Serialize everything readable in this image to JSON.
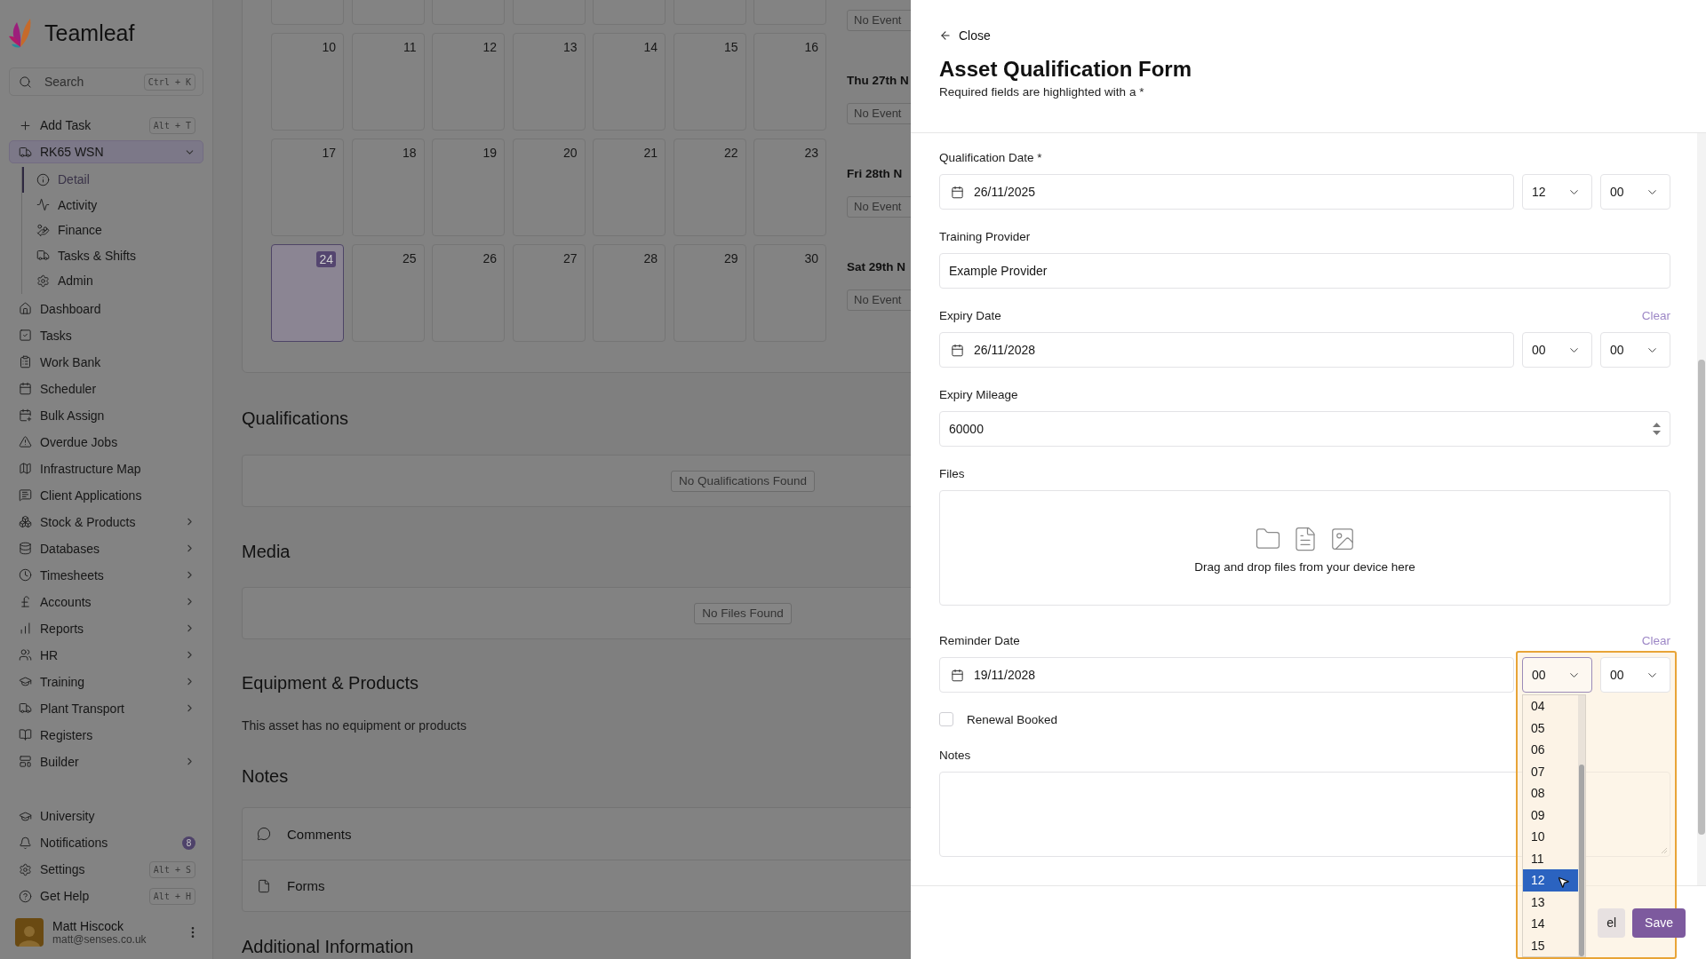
{
  "app": {
    "name": "Teamleaf"
  },
  "sidebar": {
    "search": {
      "placeholder": "Search",
      "shortcut": "Ctrl + K"
    },
    "items": [
      {
        "label": "Add Task",
        "shortcut": "Alt + T",
        "submenu": false,
        "selected": false
      },
      {
        "label": "RK65 WSN",
        "submenu": false,
        "selected": true,
        "expanded": true,
        "children": [
          {
            "label": "Detail",
            "selected": true
          },
          {
            "label": "Activity",
            "selected": false
          },
          {
            "label": "Finance",
            "selected": false
          },
          {
            "label": "Tasks & Shifts",
            "selected": false
          },
          {
            "label": "Admin",
            "selected": false
          }
        ]
      },
      {
        "label": "Dashboard",
        "submenu": false,
        "selected": false
      },
      {
        "label": "Tasks",
        "submenu": false,
        "selected": false
      },
      {
        "label": "Work Bank",
        "submenu": false,
        "selected": false
      },
      {
        "label": "Scheduler",
        "submenu": false,
        "selected": false
      },
      {
        "label": "Bulk Assign",
        "submenu": false,
        "selected": false
      },
      {
        "label": "Overdue Jobs",
        "submenu": false,
        "selected": false
      },
      {
        "label": "Infrastructure Map",
        "submenu": false,
        "selected": false
      },
      {
        "label": "Client Applications",
        "submenu": false,
        "selected": false
      },
      {
        "label": "Stock & Products",
        "submenu": true,
        "selected": false
      },
      {
        "label": "Databases",
        "submenu": true,
        "selected": false
      },
      {
        "label": "Timesheets",
        "submenu": true,
        "selected": false
      },
      {
        "label": "Accounts",
        "submenu": true,
        "selected": false
      },
      {
        "label": "Reports",
        "submenu": true,
        "selected": false
      },
      {
        "label": "HR",
        "submenu": true,
        "selected": false
      },
      {
        "label": "Training",
        "submenu": true,
        "selected": false
      },
      {
        "label": "Plant Transport",
        "submenu": true,
        "selected": false
      },
      {
        "label": "Registers",
        "submenu": false,
        "selected": false
      },
      {
        "label": "Builder",
        "submenu": true,
        "selected": false
      }
    ],
    "footer_items": [
      {
        "label": "University"
      },
      {
        "label": "Notifications",
        "badge": "8"
      },
      {
        "label": "Settings",
        "shortcut": "Alt + S"
      },
      {
        "label": "Get Help",
        "shortcut": "Alt + H"
      }
    ],
    "user": {
      "name": "Matt Hiscock",
      "email": "matt@senses.co.uk"
    }
  },
  "calendar": {
    "weeks": [
      {
        "days": [
          {
            "day": "10",
            "selected": false
          },
          {
            "day": "11",
            "selected": false
          },
          {
            "day": "12",
            "selected": false
          },
          {
            "day": "13",
            "selected": false
          },
          {
            "day": "14",
            "selected": false
          },
          {
            "day": "15",
            "selected": false
          },
          {
            "day": "16",
            "selected": false
          }
        ]
      },
      {
        "days": [
          {
            "day": "17",
            "selected": false
          },
          {
            "day": "18",
            "selected": false
          },
          {
            "day": "19",
            "selected": false
          },
          {
            "day": "20",
            "selected": false
          },
          {
            "day": "21",
            "selected": false
          },
          {
            "day": "22",
            "selected": false
          },
          {
            "day": "23",
            "selected": false
          }
        ]
      },
      {
        "days": [
          {
            "day": "24",
            "selected": true
          },
          {
            "day": "25",
            "selected": false
          },
          {
            "day": "26",
            "selected": false
          },
          {
            "day": "27",
            "selected": false
          },
          {
            "day": "28",
            "selected": false
          },
          {
            "day": "29",
            "selected": false
          },
          {
            "day": "30",
            "selected": false
          }
        ]
      }
    ],
    "agenda": [
      {
        "event": "No Event"
      },
      {
        "heading": "Thu 27th N",
        "event": "No Event"
      },
      {
        "heading": "Fri 28th N",
        "event": "No Event"
      },
      {
        "heading": "Sat 29th N",
        "event": "No Event"
      }
    ]
  },
  "sections": {
    "qualifications": {
      "title": "Qualifications",
      "empty": "No Qualifications Found"
    },
    "media": {
      "title": "Media",
      "empty": "No Files Found"
    },
    "equipment": {
      "title": "Equipment & Products",
      "text": "This asset has no equipment or products"
    },
    "notes": {
      "title": "Notes",
      "items": [
        {
          "label": "Comments",
          "kind": "comments"
        },
        {
          "label": "Forms",
          "kind": "forms"
        }
      ]
    },
    "additional": {
      "title": "Additional Information"
    }
  },
  "panel": {
    "close": "Close",
    "title": "Asset Qualification Form",
    "subtitle": "Required fields are highlighted with a *",
    "fields": [
      {
        "kind": "datetime",
        "label": "Qualification Date *",
        "value": "26/11/2025",
        "hour": "12",
        "minute": "00",
        "hour_open": false
      },
      {
        "kind": "text",
        "label": "Training Provider",
        "value": "Example Provider"
      },
      {
        "kind": "datetime",
        "label": "Expiry Date",
        "action": "Clear",
        "value": "26/11/2028",
        "hour": "00",
        "minute": "00",
        "hour_open": false
      },
      {
        "kind": "number",
        "label": "Expiry Mileage",
        "value": "60000"
      },
      {
        "kind": "files",
        "label": "Files",
        "hint": "Drag and drop files from your device here"
      },
      {
        "kind": "datetime",
        "label": "Reminder Date",
        "action": "Clear",
        "value": "19/11/2028",
        "hour": "00",
        "minute": "00",
        "hour_open": true,
        "hour_options": [
          {
            "label": "04",
            "selected": false
          },
          {
            "label": "05",
            "selected": false
          },
          {
            "label": "06",
            "selected": false
          },
          {
            "label": "07",
            "selected": false
          },
          {
            "label": "08",
            "selected": false
          },
          {
            "label": "09",
            "selected": false
          },
          {
            "label": "10",
            "selected": false
          },
          {
            "label": "11",
            "selected": false
          },
          {
            "label": "12",
            "selected": true
          },
          {
            "label": "13",
            "selected": false
          },
          {
            "label": "14",
            "selected": false
          },
          {
            "label": "15",
            "selected": false
          }
        ]
      },
      {
        "kind": "checkbox",
        "label": "Renewal Booked",
        "checked": false
      },
      {
        "kind": "textarea",
        "label": "Notes"
      }
    ],
    "footer": {
      "cancel": "el",
      "save": "Save"
    }
  }
}
